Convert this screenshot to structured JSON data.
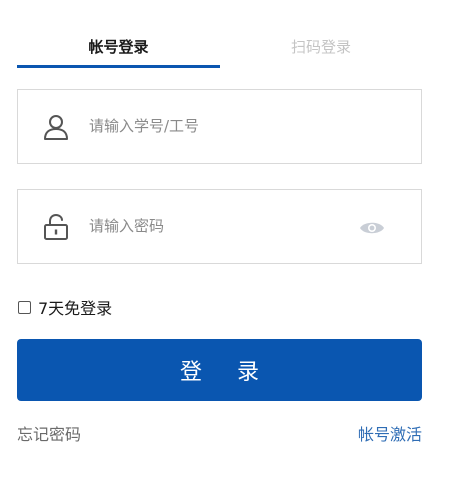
{
  "tabs": {
    "account_label": "帐号登录",
    "scan_label": "扫码登录",
    "active": "account"
  },
  "username": {
    "placeholder": "请输入学号/工号",
    "value": "",
    "icon": "user-icon"
  },
  "password": {
    "placeholder": "请输入密码",
    "value": "",
    "icon": "lock-icon",
    "toggle_icon": "eye-icon"
  },
  "remember": {
    "label": "7天免登录",
    "checked": false
  },
  "login_button": {
    "label": "登 录"
  },
  "links": {
    "forgot_password": "忘记密码",
    "activate_account": "帐号激活"
  },
  "colors": {
    "primary": "#0a56b0",
    "link": "#2f6db5",
    "inactive_tab": "#c4c4c4",
    "border": "#d9d9d9"
  }
}
